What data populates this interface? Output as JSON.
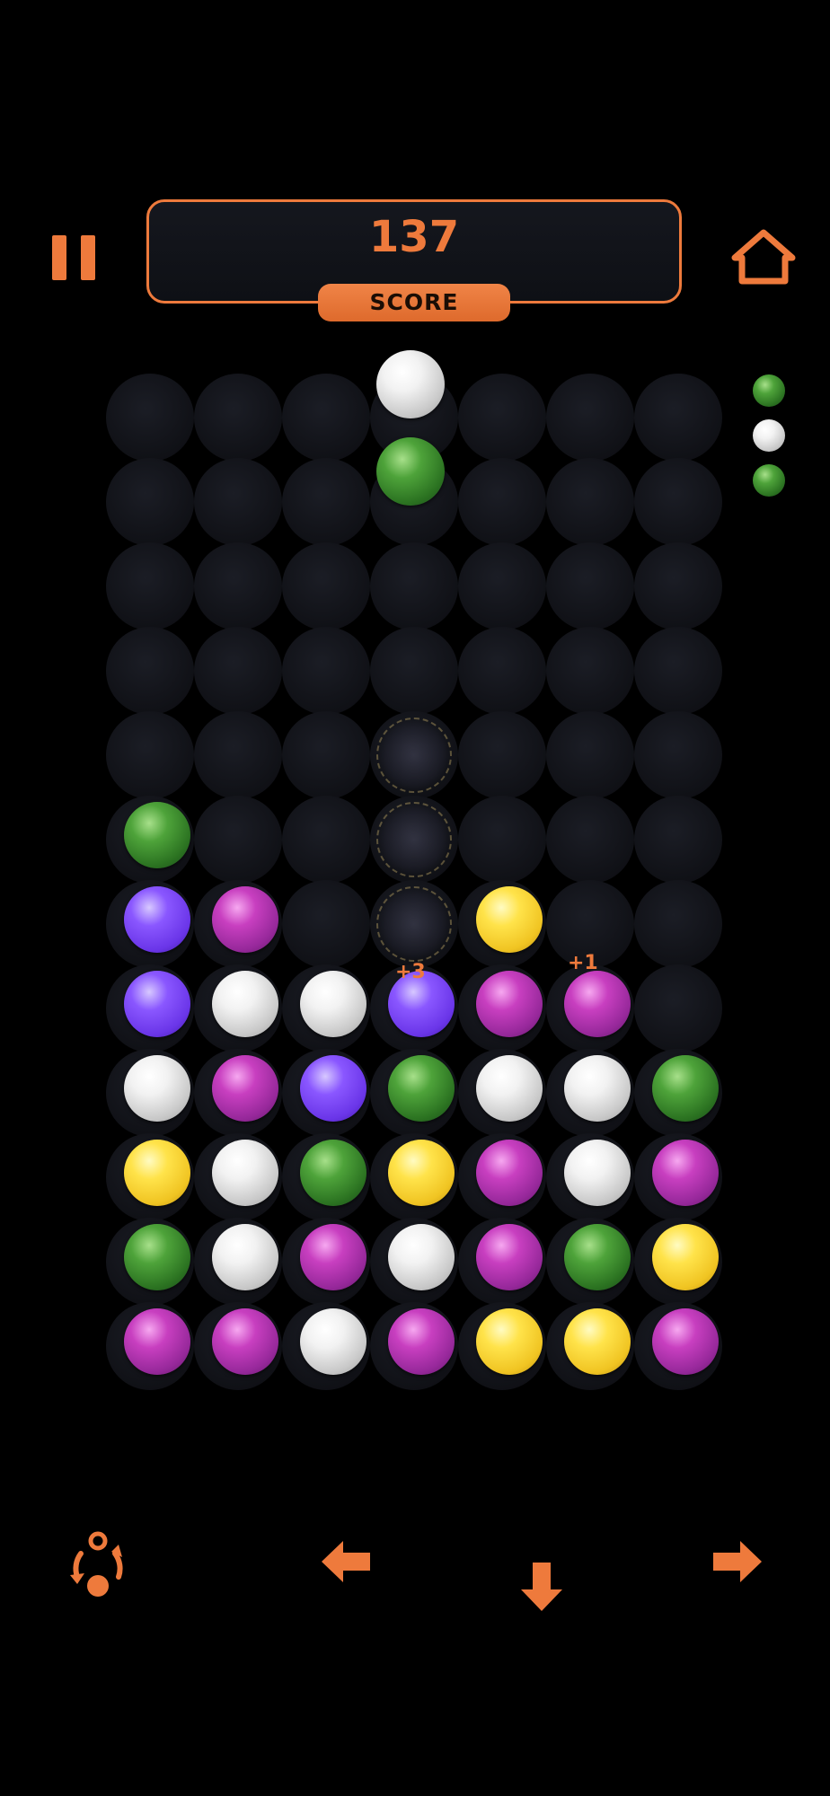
{
  "header": {
    "score_value": "137",
    "score_label": "SCORE"
  },
  "colors": {
    "accent": "#ee7a3c",
    "background": "#000000",
    "slot": "#15171e"
  },
  "icons": {
    "pause": "pause-icon",
    "home": "home-icon",
    "rotate": "rotate-icon",
    "left": "arrow-left-icon",
    "down": "arrow-down-icon",
    "right": "arrow-right-icon"
  },
  "board": {
    "columns": 7,
    "rows": 12,
    "cells": [
      [
        null,
        null,
        null,
        null,
        null,
        null,
        null
      ],
      [
        null,
        null,
        null,
        null,
        null,
        null,
        null
      ],
      [
        null,
        null,
        null,
        null,
        null,
        null,
        null
      ],
      [
        null,
        null,
        null,
        null,
        null,
        null,
        null
      ],
      [
        null,
        null,
        null,
        null,
        null,
        null,
        null
      ],
      [
        "green",
        null,
        null,
        null,
        null,
        null,
        null
      ],
      [
        "purple",
        "magenta",
        null,
        null,
        "yellow",
        null,
        null
      ],
      [
        "purple",
        "white",
        "white",
        "purple",
        "magenta",
        "magenta",
        null
      ],
      [
        "white",
        "magenta",
        "purple",
        "green",
        "white",
        "white",
        "green"
      ],
      [
        "yellow",
        "white",
        "green",
        "yellow",
        "magenta",
        "white",
        "magenta"
      ],
      [
        "green",
        "white",
        "magenta",
        "white",
        "magenta",
        "green",
        "yellow"
      ],
      [
        "magenta",
        "magenta",
        "white",
        "magenta",
        "yellow",
        "yellow",
        "magenta"
      ]
    ],
    "cleared_cells": [
      [
        4,
        3
      ],
      [
        5,
        3
      ],
      [
        6,
        3
      ]
    ]
  },
  "falling_piece": {
    "column": 3,
    "balls": [
      "white",
      "green"
    ]
  },
  "next_piece": [
    "green",
    "white",
    "green"
  ],
  "popups": {
    "combo_points": "+3",
    "bonus_points": "+1"
  }
}
